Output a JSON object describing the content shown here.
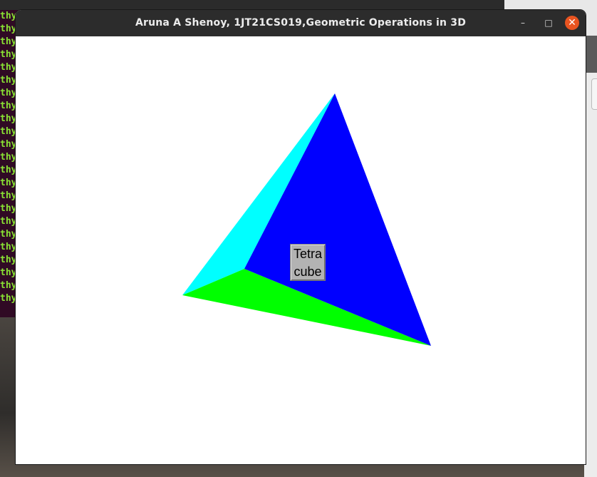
{
  "window": {
    "title": "Aruna A Shenoy, 1JT21CS019,Geometric Operations in 3D",
    "minimize_label": "–",
    "maximize_label": "□",
    "close_label": "✕"
  },
  "terminal": {
    "line_text": "thy",
    "line_color": "#8ae234"
  },
  "tetrahedron": {
    "face_colors": {
      "left": "#00ffff",
      "front": "#0000ff",
      "bottom": "#00ff00"
    }
  },
  "menu_button": {
    "line1": "Tetra",
    "line2": "cube"
  }
}
